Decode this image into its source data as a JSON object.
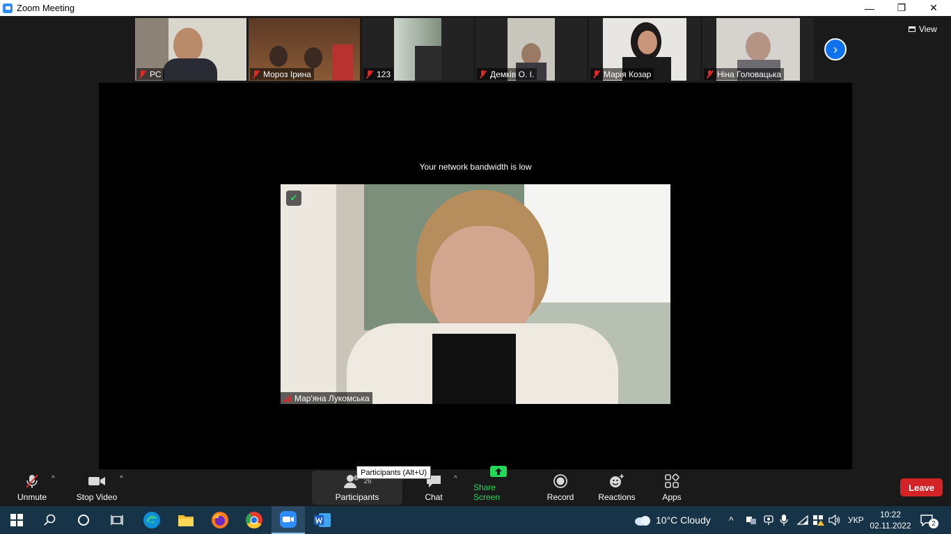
{
  "window": {
    "title": "Zoom Meeting",
    "minimize": "—",
    "restore": "❐",
    "close": "✕"
  },
  "gallery_strip": {
    "participants": [
      {
        "name": "РС"
      },
      {
        "name": "Мороз Ірина"
      },
      {
        "name": "123"
      },
      {
        "name": "Демків О. І."
      },
      {
        "name": "Марія  Козар"
      },
      {
        "name": "Ніна Головацька"
      }
    ],
    "view_label": "View"
  },
  "speaker": {
    "notice": "Your network bandwidth is low",
    "name": "Мар'яна Лукомська"
  },
  "toolbar": {
    "unmute": "Unmute",
    "stop_video": "Stop Video",
    "participants": "Participants",
    "participants_count": "26",
    "participants_tooltip": "Participants (Alt+U)",
    "chat": "Chat",
    "share_screen": "Share Screen",
    "record": "Record",
    "reactions": "Reactions",
    "apps": "Apps",
    "leave": "Leave"
  },
  "taskbar": {
    "weather": "10°C  Cloudy",
    "language": "УКР",
    "time": "10:22",
    "date": "02.11.2022",
    "notifications": "2"
  },
  "colors": {
    "accent": "#0e72ed",
    "share_green": "#23d959",
    "leave_red": "#d42326",
    "muted_red": "#e02828"
  }
}
